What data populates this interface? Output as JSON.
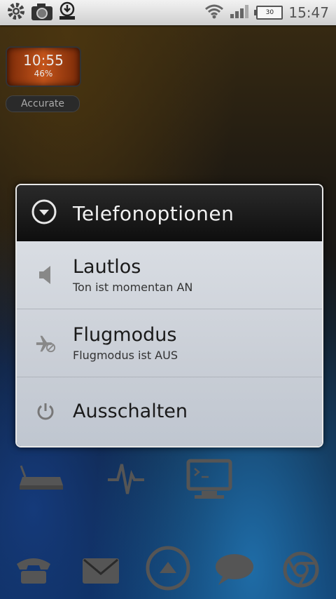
{
  "status": {
    "time": "15:47",
    "battery": "30",
    "icons": [
      "gear-icon",
      "camera-icon",
      "download-icon",
      "wifi-icon",
      "signal-icon",
      "battery-icon"
    ]
  },
  "widget": {
    "time": "10:55",
    "percent": "46%",
    "mode": "Accurate"
  },
  "dialog": {
    "title": "Telefonoptionen",
    "items": [
      {
        "label": "Lautlos",
        "sub": "Ton ist momentan AN",
        "icon": "speaker-icon"
      },
      {
        "label": "Flugmodus",
        "sub": "Flugmodus ist AUS",
        "icon": "airplane-off-icon"
      },
      {
        "label": "Ausschalten",
        "sub": "",
        "icon": "power-icon"
      }
    ]
  },
  "home_icons": [
    "router-icon",
    "pulse-icon",
    "terminal-icon"
  ],
  "dock": [
    "phone-icon",
    "mail-icon",
    "app-drawer-icon",
    "chat-icon",
    "chrome-icon"
  ]
}
